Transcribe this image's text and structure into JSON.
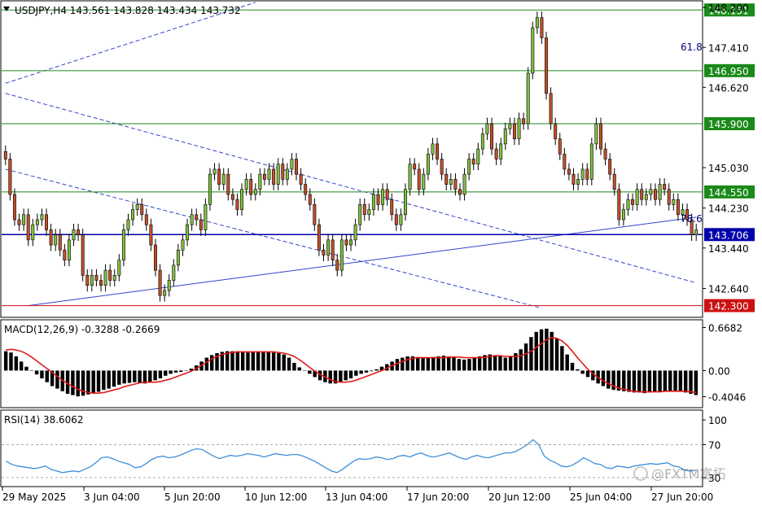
{
  "header": {
    "symbol_line": "USDJPY,H4  143.561 143.828 143.434 143.732"
  },
  "colors": {
    "bull": "#7fbf3f",
    "bear": "#c0502a",
    "green_level": "#1a8a1a",
    "red_level": "#cc1111",
    "blue_level": "#0000aa",
    "trend": "#3344cc",
    "rsi_line": "#3d8fd9",
    "macd_signal": "#e11b1b",
    "macd_hist": "#000000"
  },
  "chart_data": [
    {
      "type": "candlestick",
      "title": "USDJPY,H4",
      "ylim": [
        142.1,
        148.3
      ],
      "y_ticks": [
        "148.200",
        "147.410",
        "146.620",
        "145.030",
        "144.230",
        "143.440",
        "142.640"
      ],
      "close": [
        145.2,
        144.5,
        144.0,
        143.9,
        144.1,
        143.6,
        143.9,
        144.0,
        144.1,
        143.8,
        143.5,
        143.7,
        143.4,
        143.2,
        143.6,
        143.8,
        143.7,
        142.9,
        142.7,
        142.9,
        142.8,
        142.7,
        143.0,
        142.8,
        142.9,
        143.2,
        143.8,
        144.0,
        144.2,
        144.3,
        144.1,
        143.9,
        143.5,
        143.0,
        142.5,
        142.6,
        142.8,
        143.1,
        143.4,
        143.6,
        143.9,
        144.1,
        144.0,
        143.8,
        144.3,
        144.9,
        145.0,
        144.7,
        144.9,
        144.5,
        144.4,
        144.2,
        144.6,
        144.8,
        144.5,
        144.6,
        144.9,
        144.8,
        145.0,
        144.7,
        145.1,
        144.8,
        145.0,
        145.2,
        144.9,
        144.7,
        144.5,
        144.3,
        143.9,
        143.4,
        143.3,
        143.6,
        143.2,
        143.0,
        143.6,
        143.5,
        143.6,
        143.9,
        144.3,
        144.1,
        144.2,
        144.5,
        144.3,
        144.6,
        144.4,
        144.1,
        143.9,
        144.1,
        144.6,
        145.1,
        145.0,
        144.6,
        144.9,
        145.3,
        145.5,
        145.2,
        144.9,
        144.7,
        144.8,
        144.6,
        144.5,
        144.9,
        145.2,
        145.1,
        145.4,
        145.7,
        145.9,
        145.4,
        145.2,
        145.5,
        145.8,
        145.9,
        145.6,
        146.0,
        145.9,
        146.9,
        147.8,
        148.0,
        147.6,
        146.5,
        145.9,
        145.6,
        145.3,
        145.0,
        144.9,
        144.7,
        144.8,
        145.0,
        144.8,
        145.5,
        145.9,
        145.4,
        145.2,
        144.9,
        144.6,
        144.0,
        144.2,
        144.4,
        144.3,
        144.6,
        144.4,
        144.5,
        144.6,
        144.4,
        144.7,
        144.6,
        144.3,
        144.4,
        144.1,
        144.2,
        144.0,
        143.7,
        143.8
      ],
      "levels": [
        {
          "label": "148.151",
          "value": 148.151,
          "kind": "green"
        },
        {
          "label": "146.950",
          "value": 146.95,
          "kind": "green"
        },
        {
          "label": "145.900",
          "value": 145.9,
          "kind": "green"
        },
        {
          "label": "144.550",
          "value": 144.55,
          "kind": "green"
        },
        {
          "label": "143.706",
          "value": 143.706,
          "kind": "blue"
        },
        {
          "label": "142.300",
          "value": 142.3,
          "kind": "red"
        }
      ],
      "fib_labels": [
        "61.8",
        "78.6"
      ],
      "x_ticks": [
        "29 May 2025",
        "3 Jun 04:00",
        "5 Jun 20:00",
        "10 Jun 12:00",
        "13 Jun 04:00",
        "17 Jun 20:00",
        "20 Jun 12:00",
        "25 Jun 04:00",
        "27 Jun 20:00"
      ]
    },
    {
      "type": "bar",
      "title": "MACD(12,26,9) -0.3288 -0.2669",
      "ylim": [
        -0.55,
        0.75
      ],
      "y_ticks": [
        "0.6682",
        "0.00",
        "-0.4046"
      ],
      "histogram": [
        0.3,
        0.28,
        0.22,
        0.14,
        0.06,
        0.0,
        -0.06,
        -0.12,
        -0.18,
        -0.24,
        -0.28,
        -0.32,
        -0.36,
        -0.38,
        -0.4,
        -0.39,
        -0.37,
        -0.35,
        -0.33,
        -0.3,
        -0.28,
        -0.25,
        -0.22,
        -0.2,
        -0.19,
        -0.18,
        -0.19,
        -0.2,
        -0.18,
        -0.15,
        -0.12,
        -0.08,
        -0.05,
        -0.03,
        -0.02,
        0.0,
        0.03,
        0.08,
        0.14,
        0.2,
        0.24,
        0.27,
        0.29,
        0.3,
        0.3,
        0.3,
        0.29,
        0.28,
        0.29,
        0.3,
        0.3,
        0.29,
        0.28,
        0.27,
        0.25,
        0.2,
        0.12,
        0.05,
        0.0,
        -0.05,
        -0.1,
        -0.15,
        -0.18,
        -0.2,
        -0.2,
        -0.18,
        -0.15,
        -0.12,
        -0.08,
        -0.05,
        -0.03,
        -0.01,
        0.02,
        0.06,
        0.1,
        0.14,
        0.18,
        0.2,
        0.22,
        0.22,
        0.21,
        0.2,
        0.2,
        0.21,
        0.22,
        0.23,
        0.22,
        0.2,
        0.18,
        0.17,
        0.18,
        0.2,
        0.22,
        0.24,
        0.25,
        0.24,
        0.22,
        0.2,
        0.22,
        0.27,
        0.33,
        0.42,
        0.52,
        0.6,
        0.64,
        0.65,
        0.6,
        0.5,
        0.38,
        0.25,
        0.12,
        0.02,
        -0.05,
        -0.1,
        -0.15,
        -0.2,
        -0.24,
        -0.28,
        -0.3,
        -0.31,
        -0.32,
        -0.33,
        -0.34,
        -0.34,
        -0.35,
        -0.34,
        -0.33,
        -0.33,
        -0.32,
        -0.31,
        -0.32,
        -0.33,
        -0.34,
        -0.36,
        -0.38
      ],
      "signal": [
        0.32,
        0.33,
        0.32,
        0.3,
        0.26,
        0.21,
        0.15,
        0.09,
        0.03,
        -0.03,
        -0.09,
        -0.15,
        -0.2,
        -0.25,
        -0.29,
        -0.32,
        -0.34,
        -0.35,
        -0.35,
        -0.34,
        -0.32,
        -0.3,
        -0.28,
        -0.25,
        -0.23,
        -0.21,
        -0.19,
        -0.18,
        -0.18,
        -0.18,
        -0.17,
        -0.15,
        -0.13,
        -0.1,
        -0.07,
        -0.04,
        -0.01,
        0.03,
        0.08,
        0.13,
        0.18,
        0.22,
        0.25,
        0.27,
        0.28,
        0.29,
        0.29,
        0.29,
        0.29,
        0.29,
        0.29,
        0.29,
        0.29,
        0.28,
        0.27,
        0.25,
        0.22,
        0.17,
        0.11,
        0.05,
        -0.01,
        -0.06,
        -0.1,
        -0.14,
        -0.17,
        -0.18,
        -0.18,
        -0.17,
        -0.15,
        -0.12,
        -0.09,
        -0.06,
        -0.03,
        0.0,
        0.04,
        0.08,
        0.11,
        0.14,
        0.17,
        0.19,
        0.2,
        0.2,
        0.2,
        0.2,
        0.2,
        0.2,
        0.21,
        0.21,
        0.21,
        0.2,
        0.2,
        0.2,
        0.2,
        0.21,
        0.22,
        0.23,
        0.23,
        0.22,
        0.22,
        0.22,
        0.23,
        0.26,
        0.3,
        0.36,
        0.42,
        0.48,
        0.51,
        0.5,
        0.46,
        0.39,
        0.3,
        0.2,
        0.11,
        0.02,
        -0.05,
        -0.11,
        -0.16,
        -0.2,
        -0.24,
        -0.27,
        -0.29,
        -0.31,
        -0.32,
        -0.33,
        -0.33,
        -0.33,
        -0.33,
        -0.33,
        -0.32,
        -0.32,
        -0.32,
        -0.32,
        -0.32,
        -0.33,
        -0.34
      ]
    },
    {
      "type": "line",
      "title": "RSI(14) 38.6062",
      "ylim": [
        20,
        110
      ],
      "y_ticks": [
        "100",
        "70",
        "30"
      ],
      "values": [
        50,
        46,
        44,
        43,
        42,
        41,
        42,
        44,
        40,
        38,
        36,
        37,
        38,
        37,
        40,
        43,
        48,
        54,
        55,
        53,
        50,
        48,
        46,
        42,
        43,
        47,
        52,
        55,
        56,
        54,
        55,
        57,
        60,
        63,
        65,
        64,
        60,
        56,
        53,
        55,
        57,
        56,
        57,
        59,
        58,
        57,
        55,
        57,
        59,
        58,
        57,
        58,
        58,
        56,
        53,
        50,
        46,
        42,
        38,
        36,
        40,
        45,
        50,
        53,
        52,
        53,
        55,
        54,
        52,
        53,
        56,
        57,
        55,
        58,
        60,
        57,
        55,
        56,
        58,
        60,
        57,
        54,
        52,
        55,
        57,
        55,
        54,
        56,
        58,
        60,
        60,
        62,
        66,
        70,
        76,
        70,
        56,
        51,
        48,
        44,
        43,
        45,
        49,
        54,
        51,
        47,
        46,
        42,
        41,
        44,
        43,
        42,
        44,
        45,
        46,
        47,
        46,
        47,
        48,
        44,
        43,
        39,
        38,
        39
      ]
    }
  ]
}
